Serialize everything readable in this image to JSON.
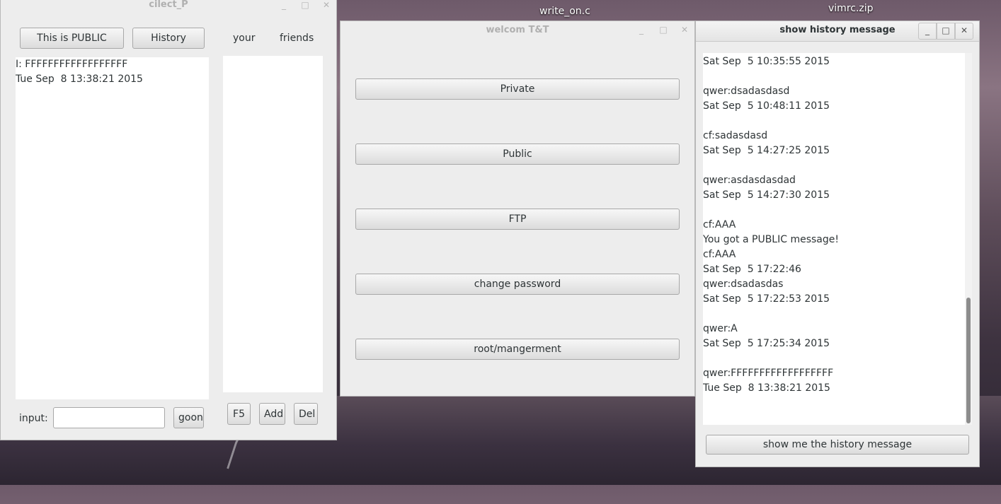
{
  "desktop": {
    "labels": [
      "write_on.c",
      "vimrc.zip"
    ]
  },
  "client_window": {
    "title": "cilect_P",
    "public_button": "This is PUBLIC",
    "history_button": "History",
    "column_your": "your",
    "column_friends": "friends",
    "messages": [
      "I: FFFFFFFFFFFFFFFFFF",
      "Tue Sep  8 13:38:21 2015"
    ],
    "input_label": "input:",
    "input_value": "",
    "goon_button": "goon",
    "f5_button": "F5",
    "add_button": "Add",
    "del_button": "Del"
  },
  "main_window": {
    "title": "welcom T&T",
    "buttons": [
      "Private",
      "Public",
      "FTP",
      "change password",
      "root/mangerment"
    ]
  },
  "history_window": {
    "title": "show history message",
    "lines": [
      "Sat Sep  5 10:35:55 2015",
      "",
      "qwer:dsadasdasd",
      "Sat Sep  5 10:48:11 2015",
      "",
      "cf:sadasdasd",
      "Sat Sep  5 14:27:25 2015",
      "",
      "qwer:asdasdasdad",
      "Sat Sep  5 14:27:30 2015",
      "",
      "cf:AAA",
      "You got a PUBLIC message!",
      "cf:AAA",
      "Sat Sep  5 17:22:46",
      "qwer:dsadasdas",
      "Sat Sep  5 17:22:53 2015",
      "",
      "qwer:A",
      "Sat Sep  5 17:25:34 2015",
      "",
      "qwer:FFFFFFFFFFFFFFFFFF",
      "Tue Sep  8 13:38:21 2015"
    ],
    "show_button": "show me the history message"
  }
}
